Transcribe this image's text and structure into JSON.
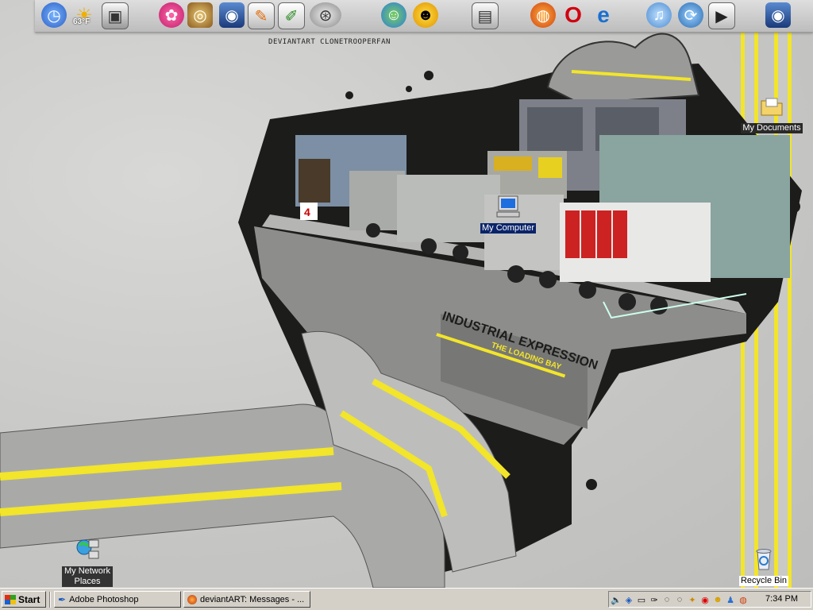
{
  "dock": {
    "caption": "DEVIANTART CLONETROOPERFAN",
    "weather_temp": "63°F",
    "icons": [
      "clock-icon",
      "weather-icon",
      "trash-can-icon",
      "flower-icon",
      "globe-icon",
      "photoshop-icon",
      "illustrator-icon",
      "paint-icon",
      "satellite-icon",
      "messenger-icon",
      "smiley-icon",
      "printer-icon",
      "firefox-icon",
      "opera-icon",
      "internet-explorer-icon",
      "itunes-icon",
      "sync-icon",
      "media-player-icon",
      "image-viewer-icon"
    ]
  },
  "desktop": {
    "my_documents": "My Documents",
    "my_computer": "My Computer",
    "network_places": "My Network Places",
    "recycle_bin": "Recycle Bin"
  },
  "wallpaper": {
    "title": "INDUSTRIAL EXPRESSION",
    "subtitle": "THE LOADING BAY",
    "dock_number": "4"
  },
  "taskbar": {
    "start_label": "Start",
    "tasks": [
      {
        "label": "Adobe Photoshop"
      },
      {
        "label": "deviantART: Messages - ..."
      }
    ],
    "clock": "7:34 PM"
  },
  "colors": {
    "accent_yellow": "#f2e52a",
    "selection_blue": "#0a246a",
    "taskbar_gray": "#d4d0c8"
  }
}
